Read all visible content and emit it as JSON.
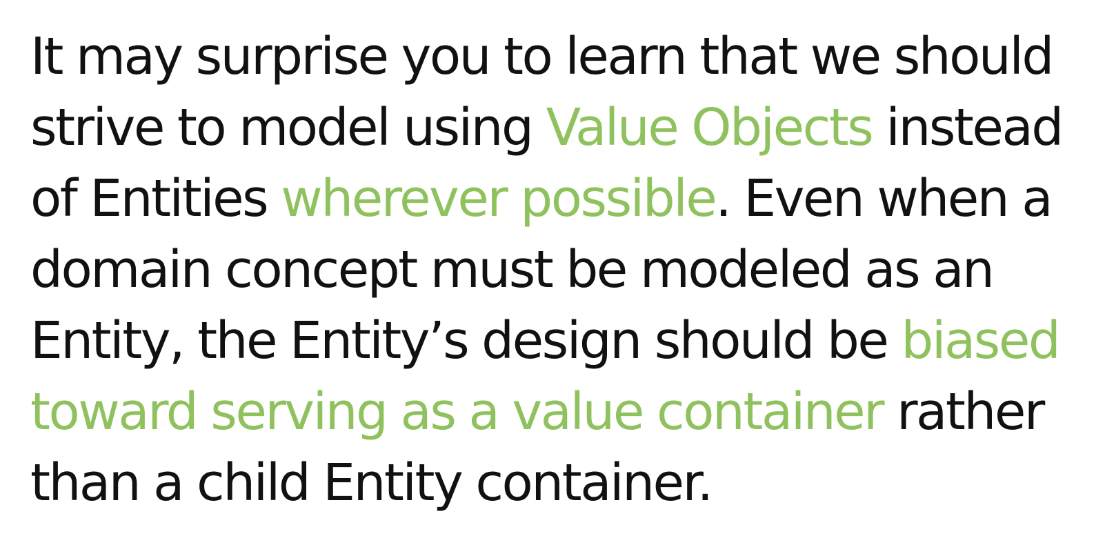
{
  "colors": {
    "text": "#111111",
    "highlight": "#8fc25e",
    "background": "#ffffff"
  },
  "quote": {
    "line1": {
      "a": "It may surprise you to learn that we should"
    },
    "line2": {
      "a": "strive to model using ",
      "b": "Value Objects",
      "c": " instead"
    },
    "line3": {
      "a": "of Entities ",
      "b": "wherever possible",
      "c": ". Even when a"
    },
    "line4": {
      "a": "domain concept must be modeled as an"
    },
    "line5": {
      "a": "Entity, the Entity’s design should be ",
      "b": "biased"
    },
    "line6": {
      "a": "toward serving as a value container",
      "b": " rather"
    },
    "line7": {
      "a": "than a child Entity container."
    }
  }
}
